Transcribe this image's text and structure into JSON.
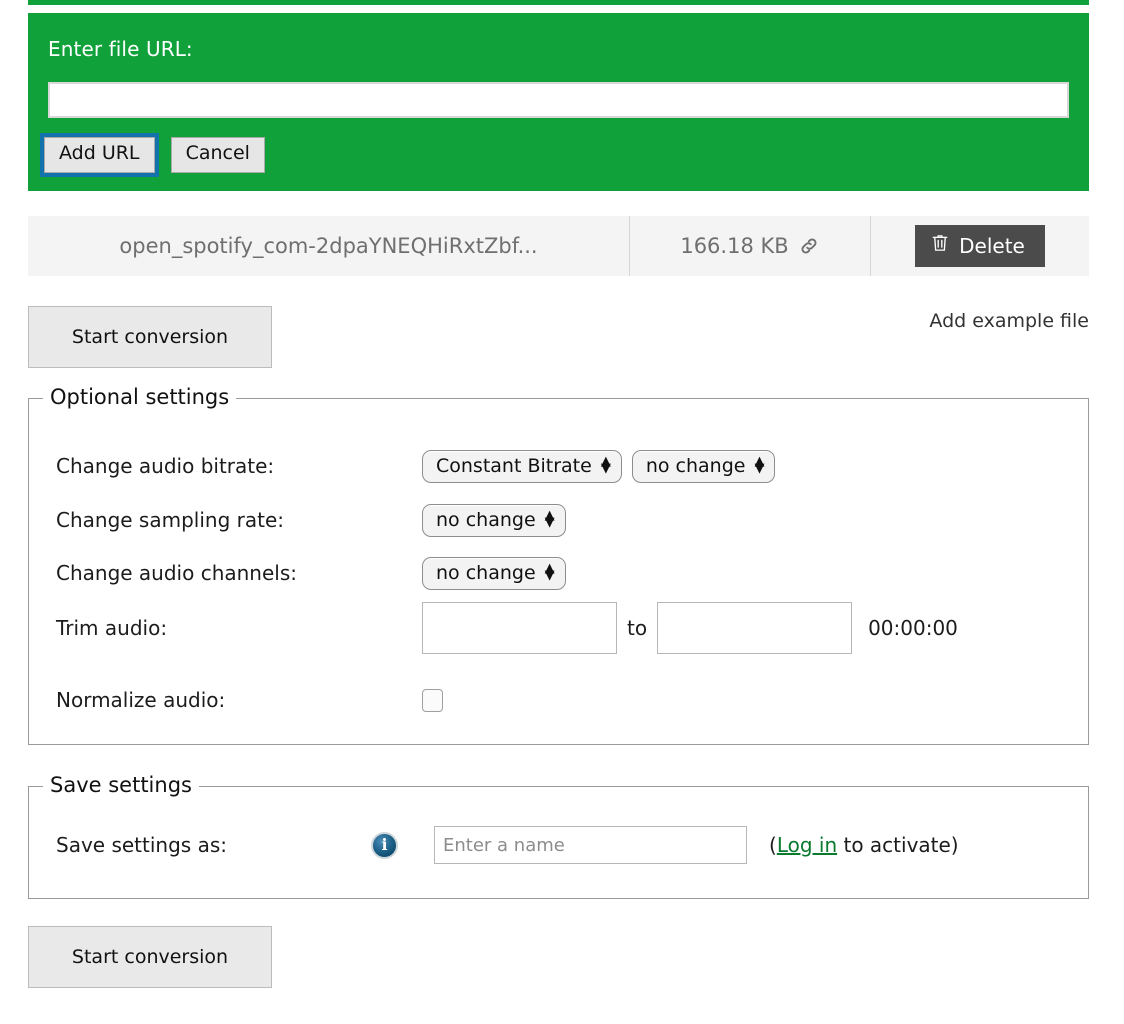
{
  "url_panel": {
    "label": "Enter file URL:",
    "input_value": "",
    "input_placeholder": "",
    "add_button": "Add URL",
    "cancel_button": "Cancel",
    "background_color": "#10a13a",
    "focus_ring_color": "#1273ac"
  },
  "file_row": {
    "name": "open_spotify_com-2dpaYNEQHiRxtZbf...",
    "size": "166.18 KB",
    "source_icon": "link-icon",
    "delete_label": "Delete",
    "delete_icon": "trash-icon",
    "delete_color": "#4b4b4b"
  },
  "actions": {
    "start_conversion_top": "Start conversion",
    "add_example_file": "Add example file",
    "start_conversion_bottom": "Start conversion"
  },
  "optional_settings": {
    "legend": "Optional settings",
    "rows": [
      {
        "label": "Change audio bitrate:",
        "controls": [
          {
            "type": "select",
            "value": "Constant Bitrate"
          },
          {
            "type": "select",
            "value": "no change"
          }
        ]
      },
      {
        "label": "Change sampling rate:",
        "controls": [
          {
            "type": "select",
            "value": "no change"
          }
        ]
      },
      {
        "label": "Change audio channels:",
        "controls": [
          {
            "type": "select",
            "value": "no change"
          }
        ]
      }
    ],
    "trim": {
      "label": "Trim audio:",
      "from_value": "",
      "separator": "to",
      "to_value": "",
      "duration": "00:00:00"
    },
    "normalize": {
      "label": "Normalize audio:",
      "checked": false
    }
  },
  "save_settings": {
    "legend": "Save settings",
    "label": "Save settings as:",
    "info_icon": "info-icon",
    "name_placeholder": "Enter a name",
    "name_value": "",
    "note_prefix": "(",
    "login_link": "Log in",
    "note_suffix": " to activate)",
    "link_color": "#0a7a2f"
  }
}
